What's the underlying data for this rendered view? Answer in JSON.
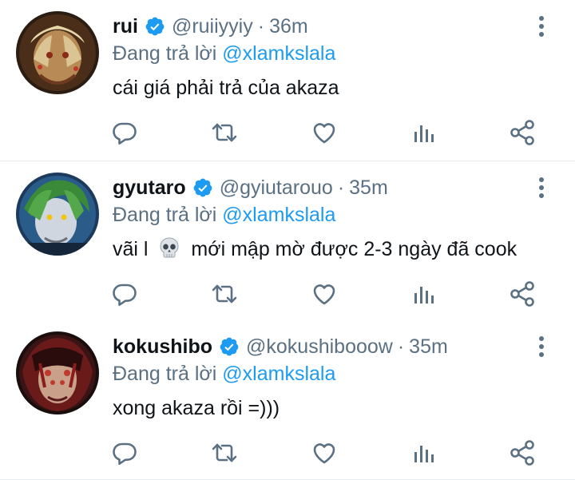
{
  "tweets": [
    {
      "name": "rui",
      "handle": "@ruiiyyiy",
      "separator": "·",
      "time": "36m",
      "reply_prefix": "Đang trả lời",
      "reply_mention": "@xlamkslala",
      "text_before": "cái giá phải trả của akaza",
      "text_after": ""
    },
    {
      "name": "gyutaro",
      "handle": "@gyiutarouo",
      "separator": "·",
      "time": "35m",
      "reply_prefix": "Đang trả lời",
      "reply_mention": "@xlamkslala",
      "text_before": "vãi l",
      "text_after": "mới mập mờ được 2-3 ngày đã cook"
    },
    {
      "name": "kokushibo",
      "handle": "@kokushibooow",
      "separator": "·",
      "time": "35m",
      "reply_prefix": "Đang trả lời",
      "reply_mention": "@xlamkslala",
      "text_before": "xong akaza rồi =)))",
      "text_after": ""
    }
  ],
  "icons": {
    "reply": "comment-icon",
    "retweet": "retweet-icon",
    "like": "heart-icon",
    "views": "analytics-icon",
    "share": "share-icon",
    "more": "more-vertical-icon",
    "verified": "verified-badge-icon",
    "emoji": "skull-emoji"
  },
  "colors": {
    "text": "#0f1419",
    "secondary": "#5b7083",
    "accent": "#1d9bf0",
    "divider": "#e6ecf0"
  }
}
